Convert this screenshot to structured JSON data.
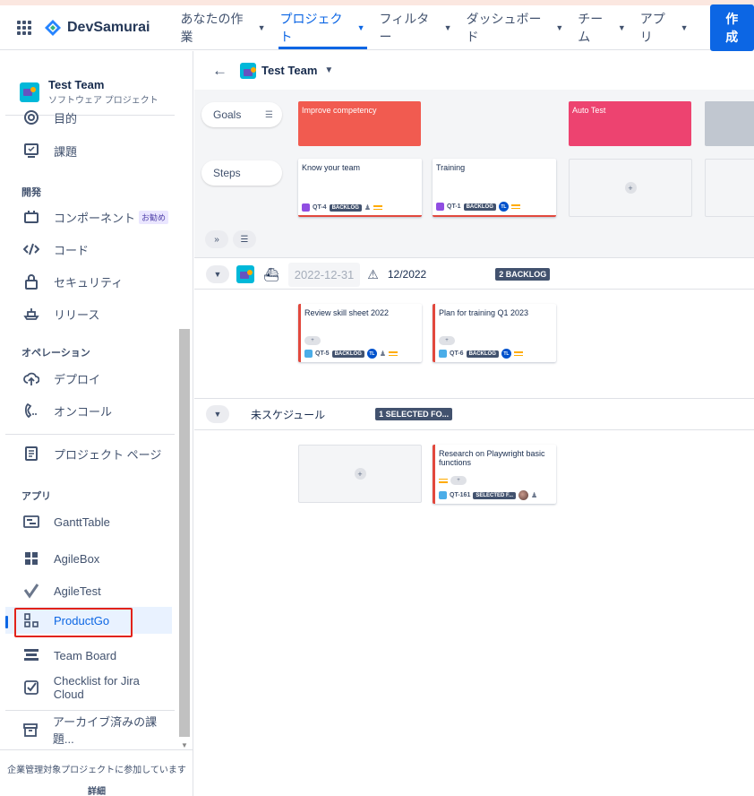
{
  "topnav": {
    "brand": "DevSamurai",
    "items": [
      {
        "label": "あなたの作業"
      },
      {
        "label": "プロジェクト"
      },
      {
        "label": "フィルター"
      },
      {
        "label": "ダッシュボード"
      },
      {
        "label": "チーム"
      },
      {
        "label": "アプリ"
      }
    ],
    "create": "作成"
  },
  "sidebar": {
    "project_name": "Test Team",
    "project_type": "ソフトウェア プロジェクト",
    "items_top": [
      {
        "label": "目的",
        "icon": "target-icon"
      },
      {
        "label": "課題",
        "icon": "issues-icon"
      }
    ],
    "group_dev": "開発",
    "dev_items": [
      {
        "label": "コンポーネント",
        "icon": "component-icon",
        "badge": "お勧め"
      },
      {
        "label": "コード",
        "icon": "code-icon"
      },
      {
        "label": "セキュリティ",
        "icon": "lock-icon"
      },
      {
        "label": "リリース",
        "icon": "ship-icon"
      }
    ],
    "group_ops": "オペレーション",
    "ops_items": [
      {
        "label": "デプロイ",
        "icon": "cloud-upload-icon"
      },
      {
        "label": "オンコール",
        "icon": "phone-icon"
      }
    ],
    "project_page": "プロジェクト ページ",
    "group_apps": "アプリ",
    "apps": [
      {
        "label": "GanttTable",
        "icon": "gantt-icon"
      },
      {
        "label": "AgileBox",
        "icon": "squares-icon"
      },
      {
        "label": "AgileTest",
        "icon": "check-icon"
      },
      {
        "label": "ProductGo",
        "icon": "productgo-icon"
      },
      {
        "label": "Team Board",
        "icon": "board-icon"
      },
      {
        "label": "Checklist for Jira Cloud",
        "icon": "checklist-icon"
      }
    ],
    "archived": "アーカイブ済みの課題...",
    "footer_text": "企業管理対象プロジェクトに参加しています",
    "footer_link": "詳細"
  },
  "main": {
    "title": "Test Team",
    "goals_label": "Goals",
    "steps_label": "Steps",
    "goals": [
      {
        "title": "Improve competency",
        "color": "#f15b50"
      },
      {
        "title": "Auto Test",
        "color": "#ed4370"
      }
    ],
    "step_cards": [
      {
        "title": "Know your team",
        "key": "QT-4",
        "status": "BACKLOG"
      },
      {
        "title": "Training",
        "key": "QT-1",
        "status": "BACKLOG",
        "assignee": "TL"
      }
    ],
    "release_row": {
      "date": "2022-12-31",
      "name": "12/2022",
      "count": "2 BACKLOG",
      "cards": [
        {
          "title": "Review skill sheet 2022",
          "key": "QT-5",
          "status": "BACKLOG",
          "assignee": "TL"
        },
        {
          "title": "Plan for training Q1 2023",
          "key": "QT-6",
          "status": "BACKLOG",
          "assignee": "TL"
        }
      ]
    },
    "unscheduled_row": {
      "name": "未スケジュール",
      "count": "1 SELECTED FO...",
      "card": {
        "title": "Research on Playwright basic functions",
        "key": "QT-161",
        "status": "SELECTED F..."
      }
    }
  }
}
